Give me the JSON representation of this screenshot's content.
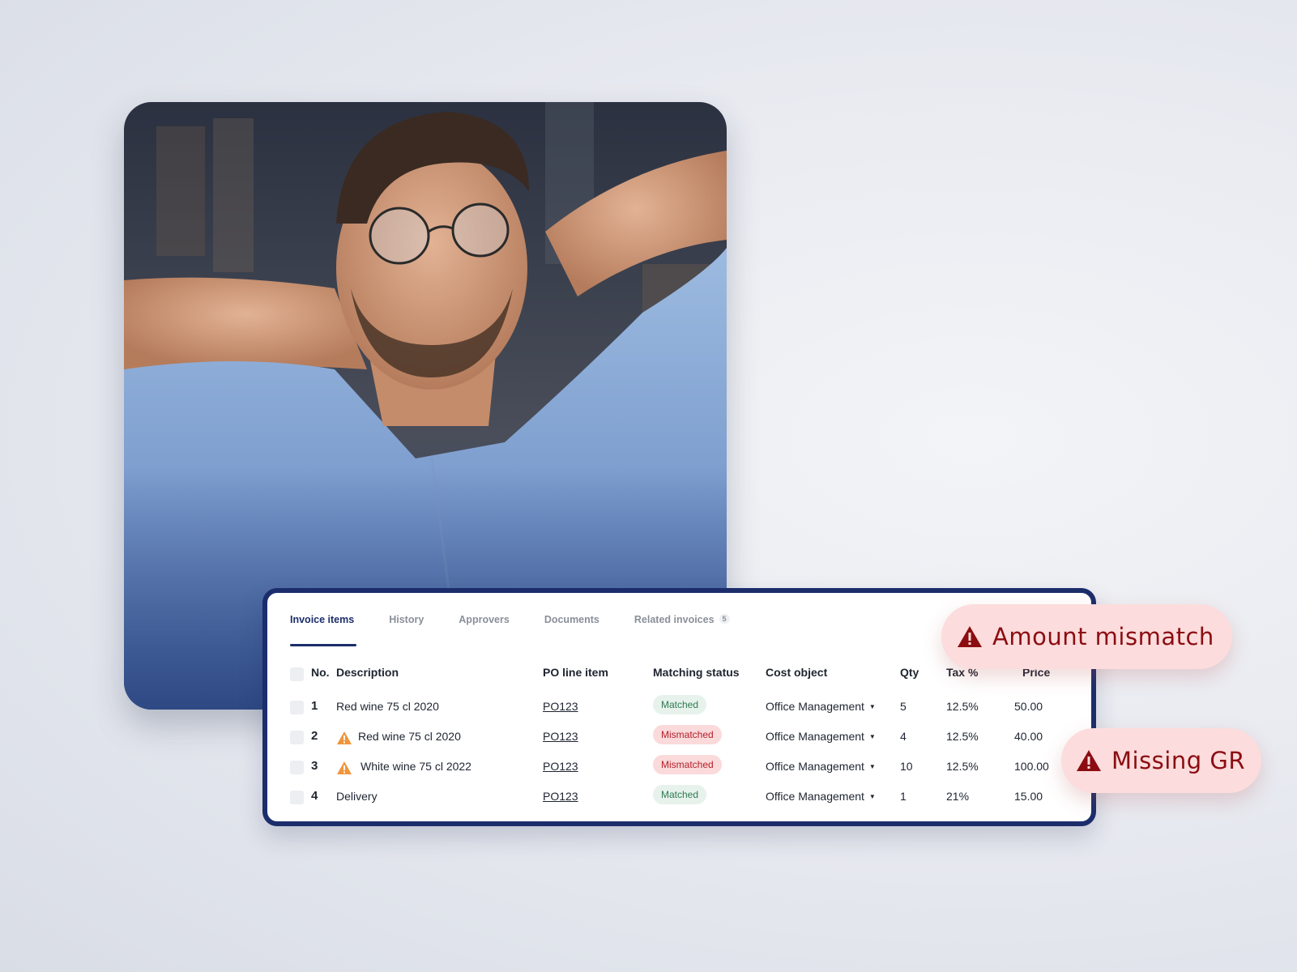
{
  "tabs": [
    {
      "label": "Invoice items",
      "active": true
    },
    {
      "label": "History"
    },
    {
      "label": "Approvers"
    },
    {
      "label": "Documents"
    },
    {
      "label": "Related invoices",
      "count": "5"
    }
  ],
  "table": {
    "headers": {
      "no": "No.",
      "description": "Description",
      "po": "PO line item",
      "status": "Matching status",
      "cost": "Cost object",
      "qty": "Qty",
      "tax": "Tax %",
      "price": "Price"
    },
    "rows": [
      {
        "no": "1",
        "description": "Red wine 75 cl 2020",
        "warning": false,
        "po": "PO123",
        "status": "Matched",
        "status_type": "ok",
        "cost": "Office Management",
        "qty": "5",
        "tax": "12.5%",
        "price": "50.00"
      },
      {
        "no": "2",
        "description": "Red wine 75 cl 2020",
        "warning": true,
        "po": "PO123",
        "status": "Mismatched",
        "status_type": "bad",
        "cost": "Office Management",
        "qty": "4",
        "tax": "12.5%",
        "price": "40.00"
      },
      {
        "no": "3",
        "description": "White wine 75 cl 2022",
        "warning": true,
        "po": "PO123",
        "status": "Mismatched",
        "status_type": "bad",
        "cost": "Office Management",
        "qty": "10",
        "tax": "12.5%",
        "price": "100.00"
      },
      {
        "no": "4",
        "description": "Delivery",
        "warning": false,
        "po": "PO123",
        "status": "Matched",
        "status_type": "ok",
        "cost": "Office Management",
        "qty": "1",
        "tax": "21%",
        "price": "15.00"
      }
    ]
  },
  "alerts": {
    "amount_mismatch": "Amount mismatch",
    "missing_gr": "Missing GR"
  },
  "icons": {
    "warning": "warning-triangle-icon",
    "caret": "caret-down-icon"
  },
  "colors": {
    "brand_navy": "#1c2d6b",
    "matched_bg": "#e7f2ec",
    "matched_text": "#2e7a50",
    "mismatch_bg": "#fadadb",
    "mismatch_text": "#b4202a",
    "alert_bg": "#fcdcdc",
    "alert_text": "#8b0d12",
    "warning_orange": "#f0953a"
  }
}
